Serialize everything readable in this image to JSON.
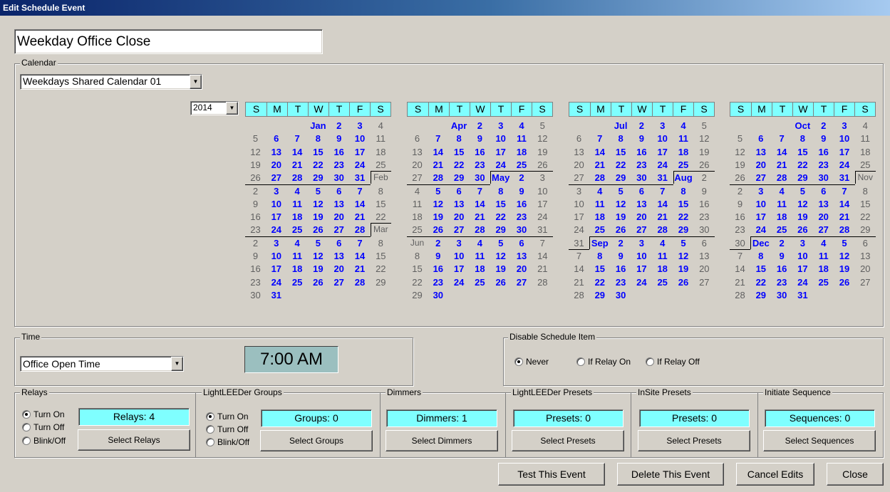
{
  "window": {
    "title": "Edit Schedule Event"
  },
  "event_name": "Weekday Office Close",
  "calendar": {
    "group_label": "Calendar",
    "selected": "Weekdays Shared Calendar 01",
    "year": "2014",
    "day_headers": [
      "S",
      "M",
      "T",
      "W",
      "T",
      "F",
      "S"
    ],
    "month_starts": [
      "Jan",
      "Feb",
      "Mar",
      "Apr",
      "May",
      "Jun",
      "Jul",
      "Aug",
      "Sep",
      "Oct",
      "Nov",
      "Dec"
    ]
  },
  "time": {
    "group_label": "Time",
    "selected": "Office Open Time",
    "display": "7:00 AM"
  },
  "disable": {
    "group_label": "Disable Schedule Item",
    "options": [
      "Never",
      "If Relay On",
      "If Relay Off"
    ],
    "selected_index": 0
  },
  "relays": {
    "label": "Relays",
    "options": [
      "Turn On",
      "Turn Off",
      "Blink/Off"
    ],
    "selected_index": 0,
    "count": "Relays: 4",
    "button": "Select Relays"
  },
  "groups": {
    "label": "LightLEEDer Groups",
    "options": [
      "Turn On",
      "Turn Off",
      "Blink/Off"
    ],
    "selected_index": 0,
    "count": "Groups: 0",
    "button": "Select Groups"
  },
  "dimmers": {
    "label": "Dimmers",
    "count": "Dimmers: 1",
    "button": "Select Dimmers"
  },
  "presets": {
    "label": "LightLEEDer Presets",
    "count": "Presets: 0",
    "button": "Select Presets"
  },
  "insite": {
    "label": "InSite Presets",
    "count": "Presets: 0",
    "button": "Select Presets"
  },
  "sequence": {
    "label": "Initiate Sequence",
    "count": "Sequences: 0",
    "button": "Select Sequences"
  },
  "footer": {
    "test": "Test This Event",
    "delete": "Delete This Event",
    "cancel": "Cancel Edits",
    "close": "Close"
  }
}
